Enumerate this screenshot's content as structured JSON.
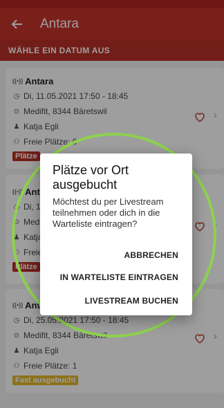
{
  "app": {
    "title": "Antara"
  },
  "section": {
    "label": "WÄHLE EIN DATUM AUS"
  },
  "cards": [
    {
      "title": "Antara",
      "datetime": "Di, 11.05.2021 17:50 - 18:45",
      "location": "Medifit, 8344 Bäretswil",
      "trainer": "Katja Egli",
      "spots": "Freie Plätze: 0",
      "badge": "Plätze"
    },
    {
      "title": "Ant",
      "datetime": "Di, 18",
      "location": "Medi",
      "trainer": "Katja",
      "spots": "Freie",
      "badge": "Plätze"
    },
    {
      "title": "Antara",
      "datetime": "Di, 25.05.2021 17:50 - 18:45",
      "location": "Medifit, 8344 Bäretswil",
      "trainer": "Katja Egli",
      "spots": "Freie Plätze: 1",
      "badge": "Fast ausgebucht"
    }
  ],
  "dialog": {
    "title": "Plätze vor Ort ausgebucht",
    "message": "Möchtest du per Livestream teilnehmen oder dich in die Warteliste eintragen?",
    "cancel": "ABBRECHEN",
    "waitlist": "IN WARTELISTE EINTRAGEN",
    "livestream": "LIVESTREAM BUCHEN"
  },
  "colors": {
    "primary": "#c6352c",
    "badge_red": "#b82f26",
    "badge_yellow": "#e1b62a",
    "highlight": "#8ed14e"
  },
  "icons": {
    "back": "arrow-left",
    "heart": "heart-outline",
    "chevron": "chevron-right",
    "live": "broadcast",
    "clock": "clock",
    "location": "pin",
    "trainer": "person",
    "spots": "people"
  }
}
